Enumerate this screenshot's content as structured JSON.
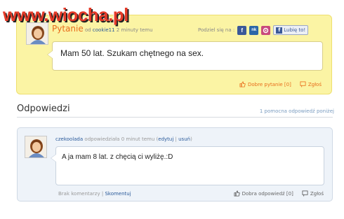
{
  "watermark": "www.wiocha.pl",
  "question": {
    "title": "Pytanie",
    "by_prefix": "od",
    "author": "cookie11",
    "time": "2 minuty temu",
    "share_label": "Podziel się na :",
    "share_icons": [
      "facebook-icon",
      "nk-icon",
      "google-icon"
    ],
    "nk_text": "nk",
    "like_label": "Lubię to!",
    "text": "Mam 50 lat. Szukam chętnego na sex.",
    "good_question": "Dobre pytanie [0]",
    "report": "Zgłoś"
  },
  "answers": {
    "heading": "Odpowiedzi",
    "count_text": "1 pomocna odpowiedź poniżej",
    "items": [
      {
        "author": "czekoolada",
        "meta": "odpowiedziała 0 minut temu",
        "edit": "edytuj",
        "delete": "usuń",
        "text": "A ja mam 8 lat. z chęcią ci wyliżę.:D",
        "no_comments": "Brak komentarzy",
        "comment": "Skomentuj",
        "good_answer": "Dobra odpowiedź [0]",
        "report": "Zgłoś"
      }
    ]
  },
  "colors": {
    "question_bg": "#fbf4a4",
    "answer_bg": "#eef3f9",
    "accent_orange": "#e86c1a",
    "link_blue": "#2a5a9a"
  }
}
